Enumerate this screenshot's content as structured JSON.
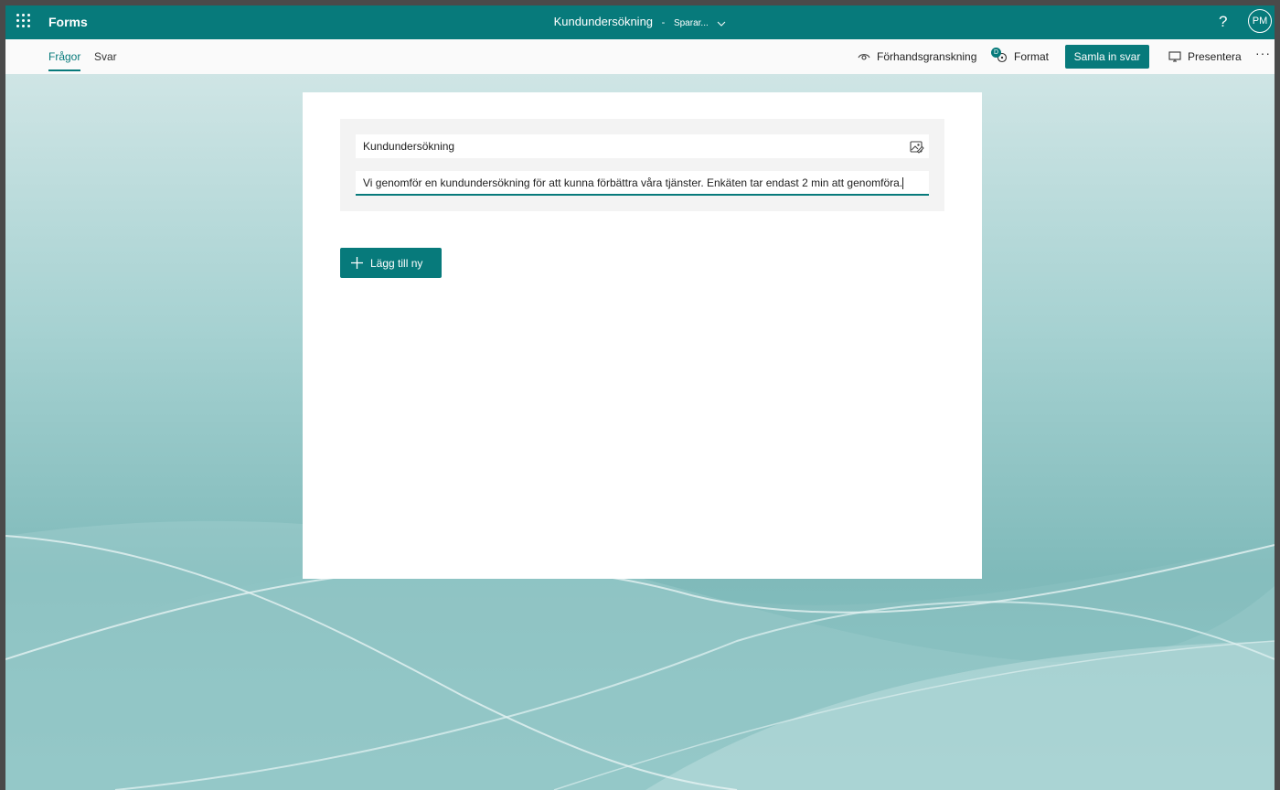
{
  "header": {
    "app_name": "Forms",
    "doc_title": "Kundundersökning",
    "separator": "-",
    "save_status": "Sparar...",
    "help": "?",
    "avatar_initials": "PM"
  },
  "tabs": [
    {
      "label": "Frågor",
      "active": true
    },
    {
      "label": "Svar",
      "active": false
    }
  ],
  "toolbar": {
    "preview_label": "Förhandsgranskning",
    "format_label": "Format",
    "format_badge": "D",
    "collect_label": "Samla in svar",
    "present_label": "Presentera",
    "more_label": "···"
  },
  "form": {
    "title": "Kundundersökning",
    "description": "Vi genomför en kundundersökning för att kunna förbättra våra tjänster. Enkäten tar endast 2 min att genomföra.",
    "add_new_label": "Lägg till ny"
  },
  "colors": {
    "accent": "#077a7b",
    "background_light": "#cfe6e6",
    "background_dark": "#6fb3b3"
  },
  "icons": [
    "app-launcher-icon",
    "chevron-down-icon",
    "help-icon",
    "eye-icon",
    "palette-icon",
    "monitor-icon",
    "more-icon",
    "image-icon",
    "plus-icon"
  ]
}
